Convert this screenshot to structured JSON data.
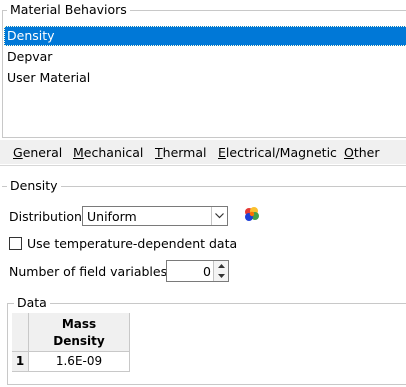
{
  "material_behaviors": {
    "title": "Material Behaviors",
    "items": [
      {
        "label": "Density",
        "selected": true
      },
      {
        "label": "Depvar",
        "selected": false
      },
      {
        "label": "User Material",
        "selected": false
      }
    ]
  },
  "menu": {
    "items": [
      {
        "label": "General",
        "mnemonic": "G",
        "rest": "eneral"
      },
      {
        "label": "Mechanical",
        "mnemonic": "M",
        "rest": "echanical"
      },
      {
        "label": "Thermal",
        "mnemonic": "T",
        "rest": "hermal"
      },
      {
        "label": "Electrical/Magnetic",
        "mnemonic": "E",
        "rest": "lectrical/Magnetic"
      },
      {
        "label": "Other",
        "mnemonic": "O",
        "rest": "ther"
      }
    ]
  },
  "density": {
    "section_title": "Density",
    "distribution_label": "Distribution:",
    "distribution_value": "Uniform",
    "temp_dependent_label": "Use temperature-dependent data",
    "temp_dependent_checked": false,
    "field_variables_label": "Number of field variables:",
    "field_variables_value": "0",
    "icon": "color-palette-icon"
  },
  "data": {
    "title": "Data",
    "column_header_line1": "Mass",
    "column_header_line2": "Density",
    "rows": [
      {
        "index": "1",
        "mass_density": "1.6E-09"
      }
    ]
  },
  "colors": {
    "selection": "#0078d7",
    "menubar_bg": "#f0f0f0",
    "border": "#c8c8c8"
  }
}
